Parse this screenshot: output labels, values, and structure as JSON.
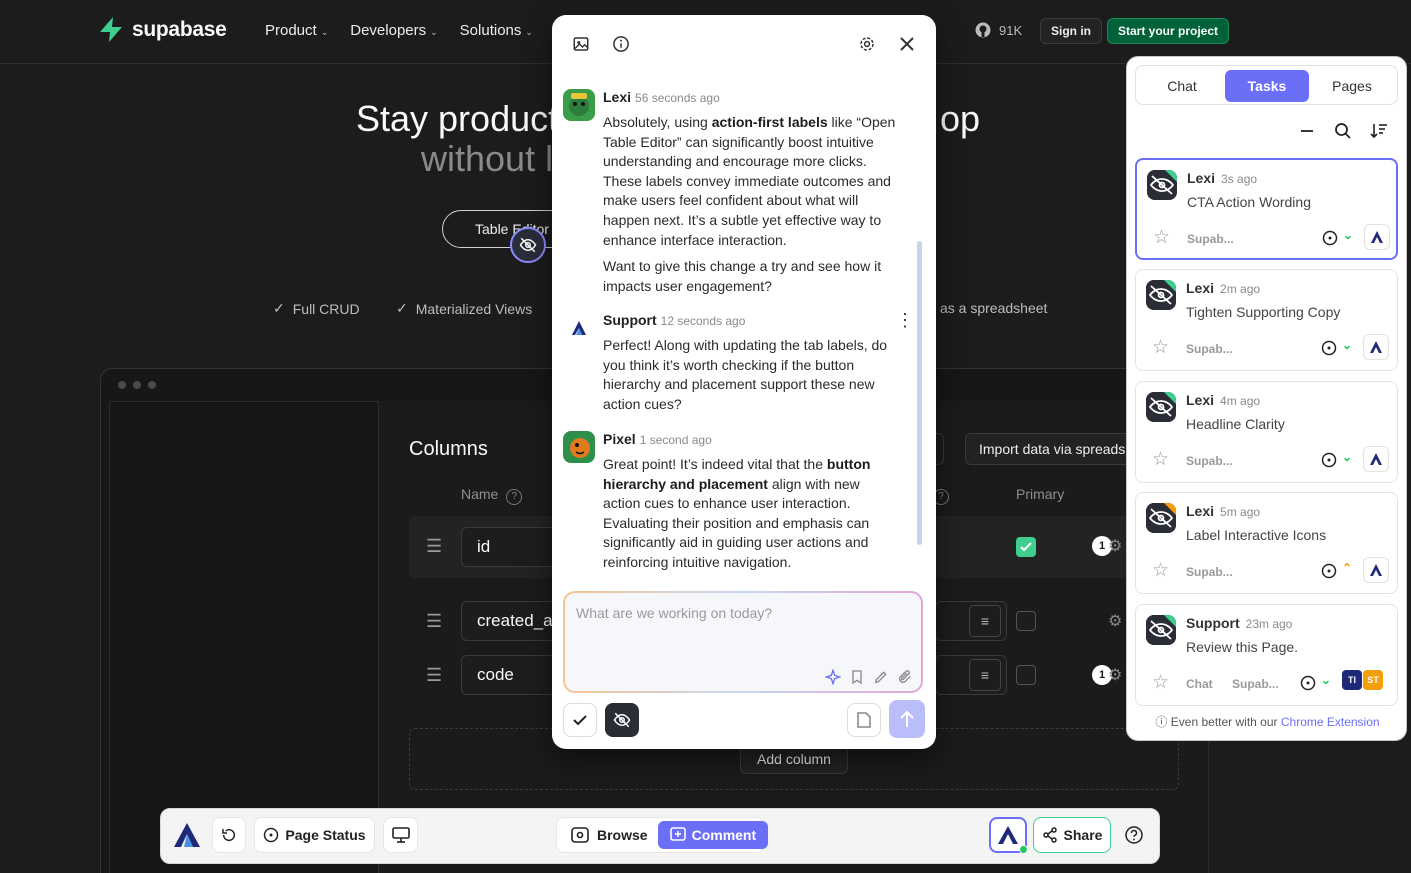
{
  "site": {
    "brand": "supabase",
    "nav": [
      "Product",
      "Developers",
      "Solutions"
    ],
    "github_stars": "91K",
    "sign_in": "Sign in",
    "start_project": "Start your project",
    "hero_line1_left": "Stay product",
    "hero_line1_right": "op",
    "hero_line2": "without l",
    "hero_pill": "Table Editor",
    "features": [
      "Full CRUD",
      "Materialized Views",
      "as a spreadsheet"
    ],
    "columns_title": "Columns",
    "import_button": "Import data via spreadsheet",
    "col_headers": {
      "name": "Name",
      "primary": "Primary"
    },
    "rows": [
      {
        "name": "id",
        "primary": true,
        "count": "1"
      },
      {
        "name": "created_at",
        "primary": false,
        "count": ""
      },
      {
        "name": "code",
        "primary": false,
        "count": "1"
      }
    ],
    "add_column": "Add column"
  },
  "chat": {
    "composer_placeholder": "What are we working on today?",
    "messages": [
      {
        "author": "Lexi",
        "time": "56 seconds ago",
        "p1_a": "Absolutely, using ",
        "p1_b": "action-first labels",
        "p1_c": " like “Open Table Editor” can significantly boost intuitive understanding and encourage more clicks. These labels convey immediate outcomes and make users feel confident about what will happen next. It’s a subtle yet effective way to enhance interface interaction.",
        "p2": "Want to give this change a try and see how it impacts user engagement?"
      },
      {
        "author": "Support",
        "time": "12 seconds ago",
        "p1": "Perfect! Along with updating the tab labels, do you think it’s worth checking if the button hierarchy and placement support these new action cues?"
      },
      {
        "author": "Pixel",
        "time": "1 second ago",
        "p1_a": "Great point! It’s indeed vital that the ",
        "p1_b": "button hierarchy and placement",
        "p1_c": " align with new action cues to enhance user interaction. Evaluating their position and emphasis can significantly aid in guiding user actions and reinforcing intuitive navigation."
      }
    ]
  },
  "tasks_panel": {
    "tabs": [
      "Chat",
      "Tasks",
      "Pages"
    ],
    "active_tab": "Tasks",
    "cards": [
      {
        "author": "Lexi",
        "time": "3s ago",
        "title": "CTA Action Wording",
        "site": "Supab...",
        "chevron": "green"
      },
      {
        "author": "Lexi",
        "time": "2m ago",
        "title": "Tighten Supporting Copy",
        "site": "Supab...",
        "chevron": "green"
      },
      {
        "author": "Lexi",
        "time": "4m ago",
        "title": "Headline Clarity",
        "site": "Supab...",
        "chevron": "green"
      },
      {
        "author": "Lexi",
        "time": "5m ago",
        "title": "Label Interactive Icons",
        "site": "Supab...",
        "chevron": "orange"
      },
      {
        "author": "Support",
        "time": "23m ago",
        "title": "Review this Page.",
        "site": "Supab...",
        "chat_label": "Chat",
        "chips": [
          "TI",
          "ST"
        ]
      }
    ],
    "footer_text": "Even better with our",
    "footer_link": "Chrome Extension"
  },
  "toolbar": {
    "page_status": "Page Status",
    "browse": "Browse",
    "comment": "Comment",
    "share": "Share"
  },
  "colors": {
    "accent": "#6b6ef7",
    "supabase_green": "#3ecf8e",
    "status_green": "#22c55e",
    "status_orange": "#f59e0b"
  }
}
